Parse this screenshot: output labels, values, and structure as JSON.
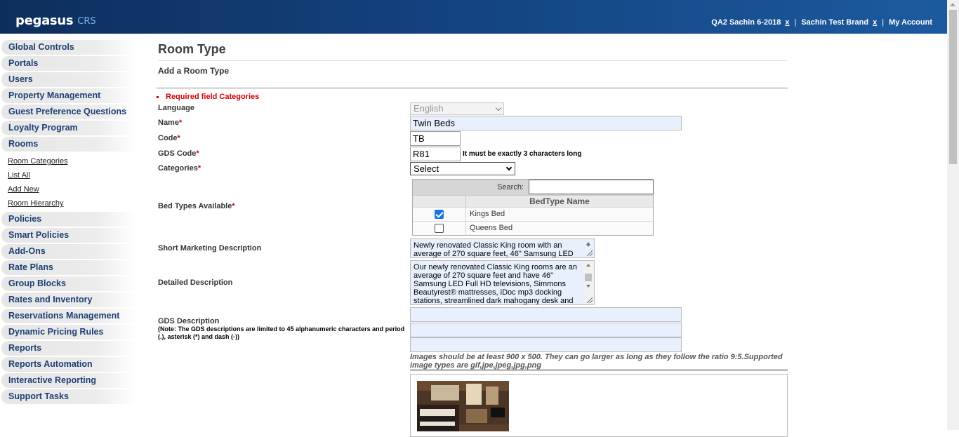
{
  "header": {
    "brand": "pegasus",
    "brand_suffix": "CRS",
    "property": "QA2 Sachin 6-2018",
    "property_close": "x",
    "brand_name": "Sachin Test Brand",
    "brand_close": "x",
    "separator": "|",
    "account": "My Account"
  },
  "sidebar": {
    "items": [
      {
        "label": "Global Controls"
      },
      {
        "label": "Portals"
      },
      {
        "label": "Users"
      },
      {
        "label": "Property Management"
      },
      {
        "label": "Guest Preference Questions"
      },
      {
        "label": "Loyalty Program"
      },
      {
        "label": "Rooms"
      }
    ],
    "sub_items": [
      {
        "label": "Room Categories"
      },
      {
        "label": "List All"
      },
      {
        "label": "Add New"
      },
      {
        "label": "Room Hierarchy"
      }
    ],
    "items_after": [
      {
        "label": "Policies"
      },
      {
        "label": "Smart Policies"
      },
      {
        "label": "Add-Ons"
      },
      {
        "label": "Rate Plans"
      },
      {
        "label": "Group Blocks"
      },
      {
        "label": "Rates and Inventory"
      },
      {
        "label": "Reservations Management"
      },
      {
        "label": "Dynamic Pricing Rules"
      },
      {
        "label": "Reports"
      },
      {
        "label": "Reports Automation"
      },
      {
        "label": "Interactive Reporting"
      },
      {
        "label": "Support Tasks"
      }
    ]
  },
  "page": {
    "title": "Room Type",
    "subtitle": "Add a Room Type",
    "error": "Required field Categories"
  },
  "form": {
    "language_label": "Language",
    "language_value": "English",
    "name_label": "Name",
    "name_value": "Twin Beds",
    "code_label": "Code",
    "code_value": "TB",
    "gds_code_label": "GDS Code",
    "gds_code_value": "R81",
    "gds_code_hint": "It must be exactly 3 characters long",
    "categories_label": "Categories",
    "categories_value": "Select",
    "required_mark": "*",
    "bed_types_label": "Bed Types Available",
    "search_label": "Search:",
    "bedtype_header": "BedType Name",
    "bed_types": [
      {
        "name": "Kings Bed",
        "checked": true
      },
      {
        "name": "Queens Bed",
        "checked": false
      }
    ],
    "short_desc_label": "Short Marketing Description",
    "short_desc_value": "Newly renovated Classic King room with an average of 270 square feet, 46\" Samsung LED",
    "detailed_desc_label": "Detailed Description",
    "detailed_desc_value": "Our newly renovated Classic King rooms are an average of 270 square feet and have 46\" Samsung LED Full HD televisions, Simmons Beautyrest® mattresses, iDoc mp3 docking stations, streamlined dark mahogany desk and",
    "gds_desc_label": "GDS Description",
    "gds_desc_note": "(Note: The GDS descriptions are limited to 45 alphanumeric characters and period (.), asterisk (*) and dash (-))",
    "image_note": "Images should be at least 900 x 500. They can go larger as long as they follow the ratio 9:5.Supported image types are gif,jpe,jpeg,jpg,png"
  },
  "colors": {
    "header_dark": "#0d2e5c",
    "nav_text": "#1d3f75",
    "required": "#d40000",
    "input_fill": "#e8f0fe",
    "checkbox_on": "#1a73e8"
  }
}
